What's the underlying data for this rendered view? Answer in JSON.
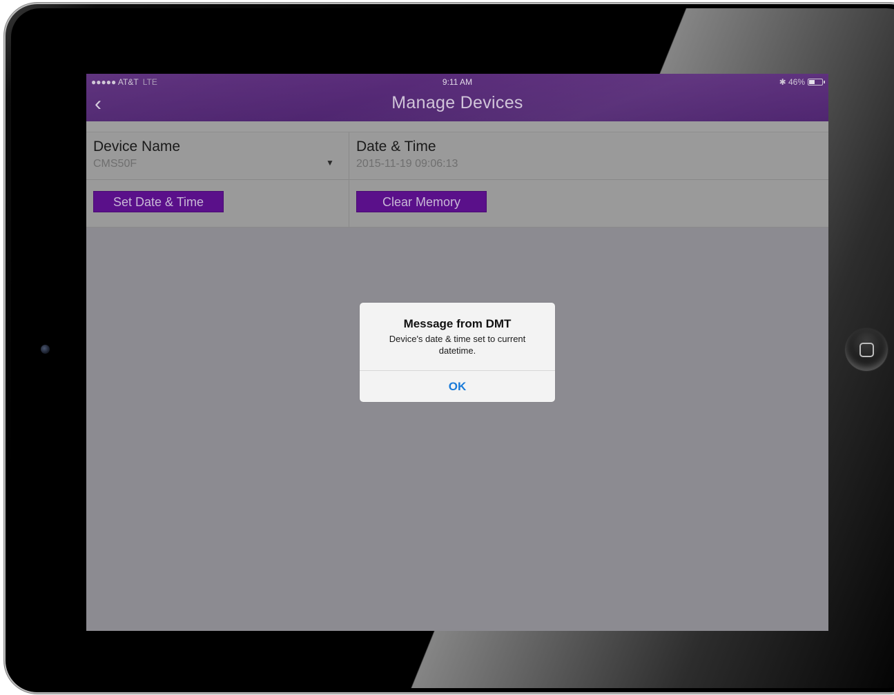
{
  "status_bar": {
    "signal": "●●●●● AT&T",
    "network": "LTE",
    "time": "9:11 AM",
    "bluetooth": "✱",
    "battery_percent": "46%",
    "battery_level": 0.46
  },
  "navbar": {
    "back_icon": "chevron-left-icon",
    "back_glyph": "‹",
    "title": "Manage Devices"
  },
  "device_name": {
    "label": "Device Name",
    "value": "CMS50F",
    "dropdown_glyph": "▼"
  },
  "date_time": {
    "label": "Date & Time",
    "value": "2015-11-19 09:06:13"
  },
  "actions": {
    "set_date_time": "Set Date & Time",
    "clear_memory": "Clear Memory"
  },
  "alert": {
    "title": "Message from DMT",
    "message": "Device's date & time set to current datetime.",
    "ok": "OK"
  },
  "colors": {
    "nav_purple": "#542a74",
    "button_purple": "#5a108a",
    "alert_link": "#1a7bd9"
  }
}
